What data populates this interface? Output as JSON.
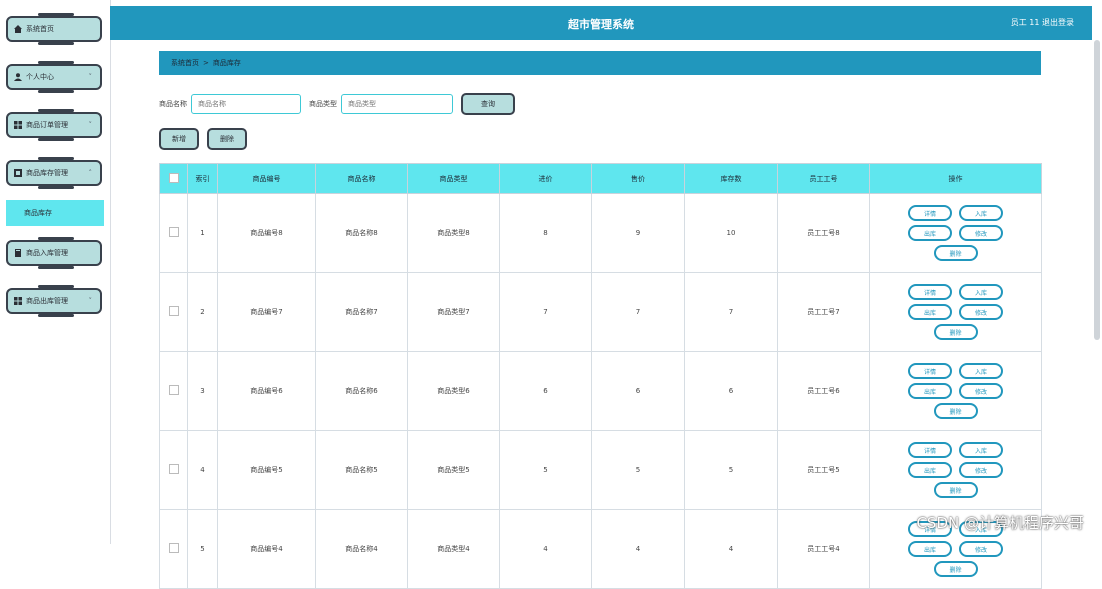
{
  "app": {
    "title": "超市管理系统",
    "user": "员工 11  退出登录"
  },
  "sidebar": {
    "items": [
      {
        "label": "系统首页",
        "icon": "home-icon",
        "chevron": ""
      },
      {
        "label": "个人中心",
        "icon": "user-icon",
        "chevron": "˅"
      },
      {
        "label": "商品订单管理",
        "icon": "grid-icon",
        "chevron": "˅"
      },
      {
        "label": "商品库存管理",
        "icon": "store-icon",
        "chevron": "˄"
      },
      {
        "label": "商品入库管理",
        "icon": "book-icon",
        "chevron": ""
      },
      {
        "label": "商品出库管理",
        "icon": "grid-icon",
        "chevron": "˅"
      }
    ],
    "sub_item": "商品库存"
  },
  "breadcrumb": {
    "home": "系统首页",
    "sep": ">",
    "current": "商品库存"
  },
  "search": {
    "name_label": "商品名称",
    "name_placeholder": "商品名称",
    "type_label": "商品类型",
    "type_placeholder": "商品类型",
    "query_button": "查询"
  },
  "actions": {
    "add": "新增",
    "delete": "删除"
  },
  "table": {
    "headers": [
      "",
      "索引",
      "商品编号",
      "商品名称",
      "商品类型",
      "进价",
      "售价",
      "库存数",
      "员工工号",
      "操作"
    ],
    "rows": [
      {
        "index": "1",
        "code": "商品编号8",
        "name": "商品名称8",
        "type": "商品类型8",
        "cost": "8",
        "price": "9",
        "stock": "10",
        "emp": "员工工号8"
      },
      {
        "index": "2",
        "code": "商品编号7",
        "name": "商品名称7",
        "type": "商品类型7",
        "cost": "7",
        "price": "7",
        "stock": "7",
        "emp": "员工工号7"
      },
      {
        "index": "3",
        "code": "商品编号6",
        "name": "商品名称6",
        "type": "商品类型6",
        "cost": "6",
        "price": "6",
        "stock": "6",
        "emp": "员工工号6"
      },
      {
        "index": "4",
        "code": "商品编号5",
        "name": "商品名称5",
        "type": "商品类型5",
        "cost": "5",
        "price": "5",
        "stock": "5",
        "emp": "员工工号5"
      },
      {
        "index": "5",
        "code": "商品编号4",
        "name": "商品名称4",
        "type": "商品类型4",
        "cost": "4",
        "price": "4",
        "stock": "4",
        "emp": "员工工号4"
      }
    ],
    "ops": {
      "detail": "详情",
      "in": "入库",
      "out": "出库",
      "edit": "修改",
      "delete": "删除"
    }
  },
  "watermark": "CSDN @计算机程序兴哥",
  "colors": {
    "header": "#2197bd",
    "accent": "#5fe6ee",
    "button_bg": "#b7dede",
    "button_border": "#39414c"
  }
}
